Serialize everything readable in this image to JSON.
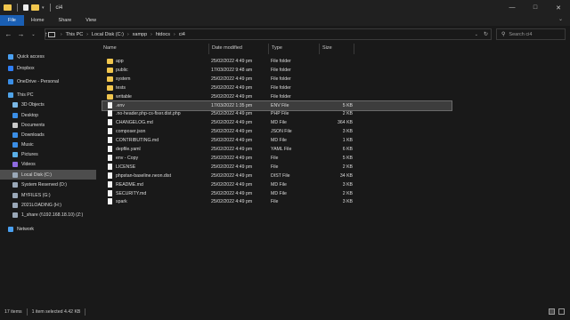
{
  "window": {
    "title": "ci4",
    "minimize": "—",
    "maximize": "□",
    "close": "✕"
  },
  "ribbon": {
    "tabs": [
      "File",
      "Home",
      "Share",
      "View"
    ]
  },
  "address": {
    "crumbs": [
      "This PC",
      "Local Disk (C:)",
      "xampp",
      "htdocs",
      "ci4"
    ]
  },
  "search": {
    "placeholder": "Search ci4"
  },
  "sidebar": {
    "items": [
      {
        "label": "Quick access",
        "icon": "star-icon",
        "color": "#4aa0f0"
      },
      {
        "label": "Dropbox",
        "icon": "dropbox-icon",
        "color": "#2f7ef5"
      },
      {
        "label": "OneDrive - Personal",
        "icon": "cloud-icon",
        "color": "#3a8ee6"
      },
      {
        "label": "This PC",
        "icon": "computer-icon",
        "color": "#4fa3e8"
      },
      {
        "label": "3D Objects",
        "icon": "cube-icon",
        "color": "#7ab8e6"
      },
      {
        "label": "Desktop",
        "icon": "desktop-icon",
        "color": "#3a8ee6"
      },
      {
        "label": "Documents",
        "icon": "documents-icon",
        "color": "#c9c9c9"
      },
      {
        "label": "Downloads",
        "icon": "download-icon",
        "color": "#3a8ee6"
      },
      {
        "label": "Music",
        "icon": "music-icon",
        "color": "#3a8ee6"
      },
      {
        "label": "Pictures",
        "icon": "pictures-icon",
        "color": "#5ab0e8"
      },
      {
        "label": "Videos",
        "icon": "videos-icon",
        "color": "#8e6ae0"
      },
      {
        "label": "Local Disk (C:)",
        "icon": "drive-icon",
        "color": "#9aa8b8"
      },
      {
        "label": "System Reserved (D:)",
        "icon": "drive-icon",
        "color": "#9aa8b8"
      },
      {
        "label": "MYFILES (G:)",
        "icon": "drive-icon",
        "color": "#9aa8b8"
      },
      {
        "label": "2021LOADING (H:)",
        "icon": "drive-icon",
        "color": "#9aa8b8"
      },
      {
        "label": "1_share (\\\\192.168.18.10) (Z:)",
        "icon": "network-drive-icon",
        "color": "#9aa8b8"
      },
      {
        "label": "Network",
        "icon": "network-icon",
        "color": "#4aa0f0"
      }
    ]
  },
  "columns": {
    "name": "Name",
    "date": "Date modified",
    "type": "Type",
    "size": "Size"
  },
  "files": [
    {
      "name": "app",
      "date": "25/02/2022 4:49 pm",
      "type": "File folder",
      "size": "",
      "kind": "folder"
    },
    {
      "name": "public",
      "date": "17/03/2022 9:48 am",
      "type": "File folder",
      "size": "",
      "kind": "folder"
    },
    {
      "name": "system",
      "date": "25/02/2022 4:49 pm",
      "type": "File folder",
      "size": "",
      "kind": "folder"
    },
    {
      "name": "tests",
      "date": "25/02/2022 4:49 pm",
      "type": "File folder",
      "size": "",
      "kind": "folder"
    },
    {
      "name": "writable",
      "date": "25/02/2022 4:49 pm",
      "type": "File folder",
      "size": "",
      "kind": "folder"
    },
    {
      "name": ".env",
      "date": "17/03/2022 1:35 pm",
      "type": "ENV File",
      "size": "5 KB",
      "kind": "file"
    },
    {
      "name": ".no-header.php-cs-fixer.dist.php",
      "date": "25/02/2022 4:49 pm",
      "type": "PHP File",
      "size": "2 KB",
      "kind": "file"
    },
    {
      "name": "CHANGELOG.md",
      "date": "25/02/2022 4:49 pm",
      "type": "MD File",
      "size": "364 KB",
      "kind": "file"
    },
    {
      "name": "composer.json",
      "date": "25/02/2022 4:49 pm",
      "type": "JSON File",
      "size": "3 KB",
      "kind": "file"
    },
    {
      "name": "CONTRIBUTING.md",
      "date": "25/02/2022 4:49 pm",
      "type": "MD File",
      "size": "1 KB",
      "kind": "file"
    },
    {
      "name": "depfile.yaml",
      "date": "25/02/2022 4:49 pm",
      "type": "YAML File",
      "size": "6 KB",
      "kind": "file"
    },
    {
      "name": "env - Copy",
      "date": "25/02/2022 4:49 pm",
      "type": "File",
      "size": "5 KB",
      "kind": "file"
    },
    {
      "name": "LICENSE",
      "date": "25/02/2022 4:49 pm",
      "type": "File",
      "size": "2 KB",
      "kind": "file"
    },
    {
      "name": "phpstan-baseline.neon.dist",
      "date": "25/02/2022 4:49 pm",
      "type": "DIST File",
      "size": "34 KB",
      "kind": "file"
    },
    {
      "name": "README.md",
      "date": "25/02/2022 4:49 pm",
      "type": "MD File",
      "size": "3 KB",
      "kind": "file"
    },
    {
      "name": "SECURITY.md",
      "date": "25/02/2022 4:49 pm",
      "type": "MD File",
      "size": "2 KB",
      "kind": "file"
    },
    {
      "name": "spark",
      "date": "25/02/2022 4:49 pm",
      "type": "File",
      "size": "3 KB",
      "kind": "file"
    }
  ],
  "status": {
    "count": "17 items",
    "selected": "1 item selected  4.42 KB"
  }
}
